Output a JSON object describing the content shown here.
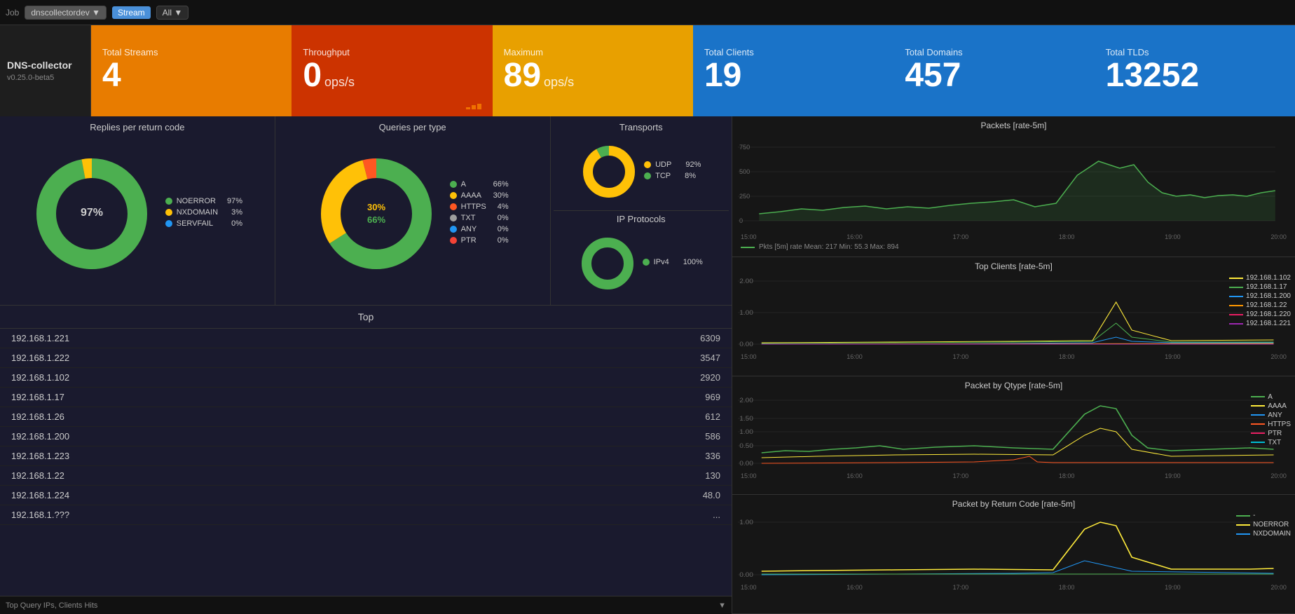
{
  "topbar": {
    "job_label": "Job",
    "job_value": "dnscollectordev",
    "stream_label": "Stream",
    "stream_filter": "All",
    "stream_dropdown": "▼"
  },
  "dns_info": {
    "title": "DNS-collector",
    "version": "v0.25.0-beta5"
  },
  "stats": {
    "total_streams": {
      "label": "Total Streams",
      "value": "4"
    },
    "throughput": {
      "label": "Throughput",
      "value": "0",
      "unit": "ops/s"
    },
    "maximum": {
      "label": "Maximum",
      "value": "89",
      "unit": "ops/s"
    },
    "total_clients": {
      "label": "Total Clients",
      "value": "19"
    },
    "total_domains": {
      "label": "Total Domains",
      "value": "457"
    },
    "total_tlds": {
      "label": "Total TLDs",
      "value": "13252"
    }
  },
  "replies_chart": {
    "title": "Replies per return code",
    "legend": [
      {
        "label": "NOERROR",
        "pct": "97%",
        "color": "#4caf50"
      },
      {
        "label": "NXDOMAIN",
        "pct": "3%",
        "color": "#ffc107"
      },
      {
        "label": "SERVFAIL",
        "pct": "0%",
        "color": "#2196f3"
      }
    ],
    "center_pct": "97%"
  },
  "queries_chart": {
    "title": "Queries per type",
    "legend": [
      {
        "label": "A",
        "pct": "66%",
        "color": "#4caf50"
      },
      {
        "label": "AAAA",
        "pct": "30%",
        "color": "#ffc107"
      },
      {
        "label": "HTTPS",
        "pct": "4%",
        "color": "#ff5722"
      },
      {
        "label": "TXT",
        "pct": "0%",
        "color": "#9e9e9e"
      },
      {
        "label": "ANY",
        "pct": "0%",
        "color": "#2196f3"
      },
      {
        "label": "PTR",
        "pct": "0%",
        "color": "#f44336"
      }
    ],
    "center_pct_main": "66%",
    "center_pct_sub": "30%"
  },
  "transports_chart": {
    "title": "Transports",
    "legend": [
      {
        "label": "UDP",
        "pct": "92%",
        "color": "#ffc107"
      },
      {
        "label": "TCP",
        "pct": "8%",
        "color": "#4caf50"
      }
    ]
  },
  "ip_protocols_chart": {
    "title": "IP Protocols",
    "legend": [
      {
        "label": "IPv4",
        "pct": "100%",
        "color": "#4caf50"
      }
    ]
  },
  "top_section": {
    "title": "Top",
    "rows": [
      {
        "ip": "192.168.1.221",
        "count": "6309"
      },
      {
        "ip": "192.168.1.222",
        "count": "3547"
      },
      {
        "ip": "192.168.1.102",
        "count": "2920"
      },
      {
        "ip": "192.168.1.17",
        "count": "969"
      },
      {
        "ip": "192.168.1.26",
        "count": "612"
      },
      {
        "ip": "192.168.1.200",
        "count": "586"
      },
      {
        "ip": "192.168.1.223",
        "count": "336"
      },
      {
        "ip": "192.168.1.22",
        "count": "130"
      },
      {
        "ip": "192.168.1.224",
        "count": "48.0"
      },
      {
        "ip": "192.168.1.???",
        "count": "..."
      }
    ],
    "bottom_label": "Top Query IPs, Clients Hits"
  },
  "packets_chart": {
    "title": "Packets [rate-5m]",
    "y_labels": [
      "750",
      "500",
      "250",
      "0"
    ],
    "x_labels": [
      "15:00",
      "16:00",
      "17:00",
      "18:00",
      "19:00",
      "20:00"
    ],
    "stats": "Pkts [5m] rate  Mean: 217  Min: 55.3  Max: 894",
    "color": "#4caf50"
  },
  "top_clients_chart": {
    "title": "Top Clients [rate-5m]",
    "y_labels": [
      "2.00",
      "1.00",
      "0.00"
    ],
    "x_labels": [
      "15:00",
      "16:00",
      "17:00",
      "18:00",
      "19:00",
      "20:00"
    ],
    "legend": [
      {
        "label": "192.168.1.102",
        "color": "#ffeb3b"
      },
      {
        "label": "192.168.1.17",
        "color": "#4caf50"
      },
      {
        "label": "192.168.1.200",
        "color": "#2196f3"
      },
      {
        "label": "192.168.1.22",
        "color": "#ff9800"
      },
      {
        "label": "192.168.1.220",
        "color": "#e91e63"
      },
      {
        "label": "192.168.1.221",
        "color": "#9c27b0"
      }
    ]
  },
  "packet_qtype_chart": {
    "title": "Packet by Qtype [rate-5m]",
    "y_labels": [
      "2.00",
      "1.50",
      "1.00",
      "0.50",
      "0.00"
    ],
    "x_labels": [
      "15:00",
      "16:00",
      "17:00",
      "18:00",
      "19:00",
      "20:00"
    ],
    "legend": [
      {
        "label": "A",
        "color": "#4caf50"
      },
      {
        "label": "AAAA",
        "color": "#ffeb3b"
      },
      {
        "label": "ANY",
        "color": "#2196f3"
      },
      {
        "label": "HTTPS",
        "color": "#ff5722"
      },
      {
        "label": "PTR",
        "color": "#e91e63"
      },
      {
        "label": "TXT",
        "color": "#00bcd4"
      }
    ]
  },
  "packet_rcode_chart": {
    "title": "Packet by Return Code [rate-5m]",
    "y_labels": [
      "1.00",
      "0.00"
    ],
    "x_labels": [
      "15:00",
      "16:00",
      "17:00",
      "18:00",
      "19:00",
      "20:00"
    ],
    "legend": [
      {
        "label": "-",
        "color": "#4caf50"
      },
      {
        "label": "NOERROR",
        "color": "#ffeb3b"
      },
      {
        "label": "NXDOMAIN",
        "color": "#2196f3"
      }
    ]
  }
}
